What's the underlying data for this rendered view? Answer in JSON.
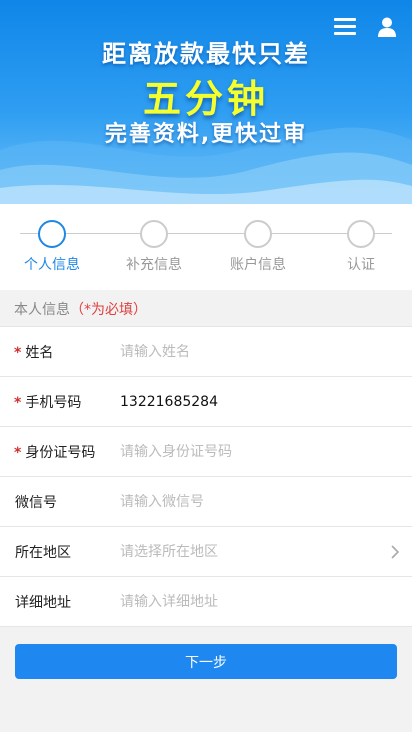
{
  "banner": {
    "line1": "距离放款最快只差",
    "line2": "五分钟",
    "line3": "完善资料,更快过审",
    "menu_icon": "menu-icon",
    "user_icon": "user-icon"
  },
  "steps": [
    {
      "label": "个人信息",
      "active": true
    },
    {
      "label": "补充信息",
      "active": false
    },
    {
      "label": "账户信息",
      "active": false
    },
    {
      "label": "认证",
      "active": false
    }
  ],
  "section": {
    "title": "本人信息",
    "required_note": "（*为必填）"
  },
  "form": {
    "name": {
      "label": "姓名",
      "required": true,
      "value": "",
      "placeholder": "请输入姓名"
    },
    "phone": {
      "label": "手机号码",
      "required": true,
      "value": "13221685284",
      "placeholder": ""
    },
    "id_number": {
      "label": "身份证号码",
      "required": true,
      "value": "",
      "placeholder": "请输入身份证号码"
    },
    "wechat": {
      "label": "微信号",
      "required": false,
      "value": "",
      "placeholder": "请输入微信号"
    },
    "region": {
      "label": "所在地区",
      "required": false,
      "value": "",
      "placeholder": "请选择所在地区"
    },
    "address": {
      "label": "详细地址",
      "required": false,
      "value": "",
      "placeholder": "请输入详细地址"
    }
  },
  "star": "*",
  "next_label": "下一步",
  "colors": {
    "accent": "#1e88f0",
    "required": "#d03030",
    "highlight_text": "#f6ff2e"
  }
}
